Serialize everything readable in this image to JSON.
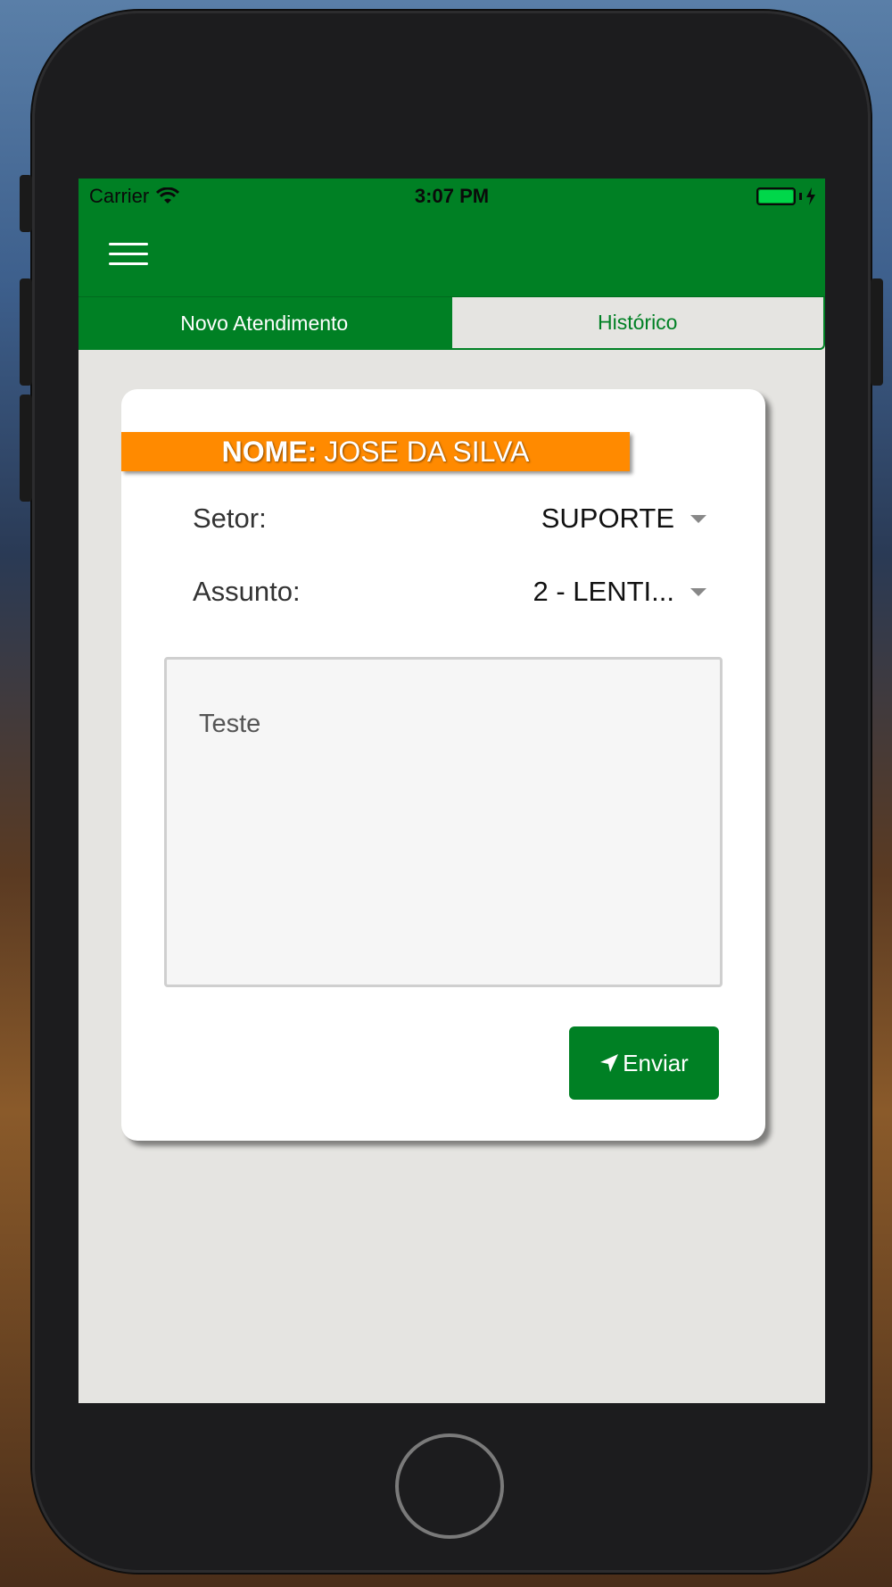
{
  "status_bar": {
    "carrier": "Carrier",
    "time": "3:07 PM"
  },
  "tabs": [
    {
      "label": "Novo Atendimento",
      "active": true
    },
    {
      "label": "Histórico",
      "active": false
    }
  ],
  "form": {
    "name_label": "NOME:",
    "name_value": "JOSE DA SILVA",
    "setor_label": "Setor:",
    "setor_value": "SUPORTE",
    "assunto_label": "Assunto:",
    "assunto_value": "2 - LENTI...",
    "message_value": "Teste",
    "send_label": "Enviar"
  },
  "colors": {
    "primary": "#008024",
    "banner": "#ff8a00",
    "background": "#e5e4e1"
  },
  "icons": [
    "wifi-icon",
    "battery-icon",
    "charging-icon",
    "hamburger-menu-icon",
    "send-icon"
  ]
}
